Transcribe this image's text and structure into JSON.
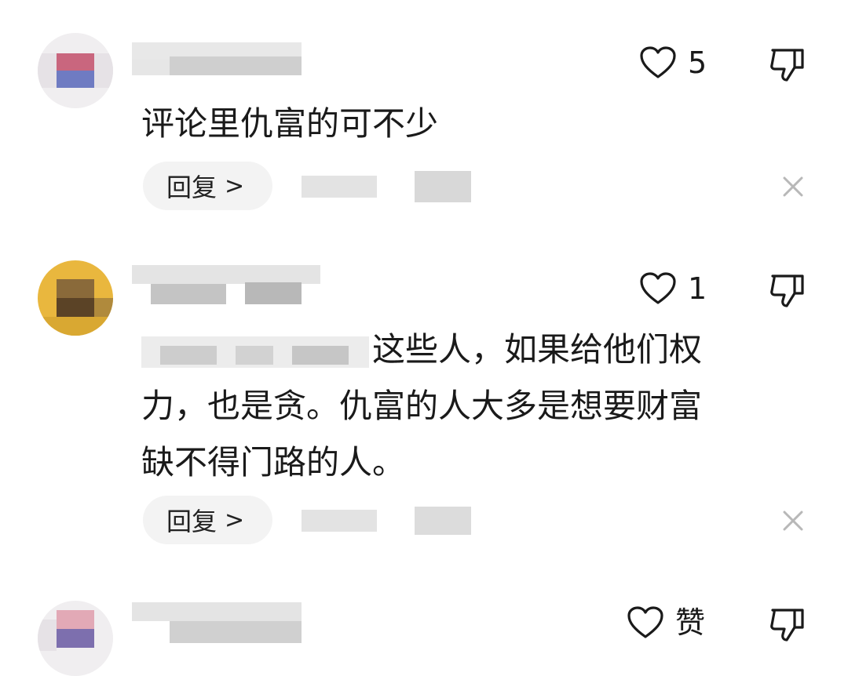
{
  "comments": [
    {
      "like_count": "5",
      "text_lines": [
        "评论里仇富的可不少"
      ],
      "reply_label": "回复",
      "reply_chevron": ">"
    },
    {
      "like_count": "1",
      "text_line1_suffix": "这些人，如果给他们权",
      "text_lines": [
        "力，也是贪。仇富的人大多是想要财富",
        "缺不得门路的人。"
      ],
      "reply_label": "回复",
      "reply_chevron": ">"
    },
    {
      "like_label": "赞"
    }
  ],
  "icons": {
    "like": "heart-outline-icon",
    "dislike": "thumbs-down-icon",
    "close": "close-icon"
  },
  "colors": {
    "text": "#1a1a1a",
    "reply_pill_bg": "#f3f3f3",
    "icon_stroke": "#1a1a1a",
    "close_icon": "#b8b8b8"
  }
}
